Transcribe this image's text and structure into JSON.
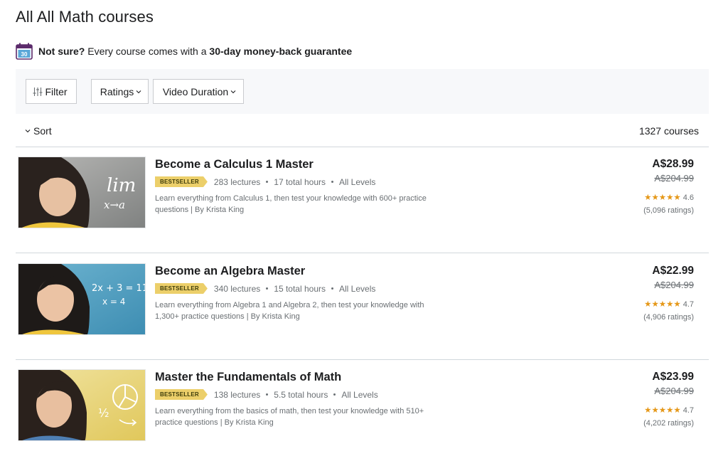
{
  "page": {
    "title": "All All Math courses"
  },
  "guarantee": {
    "lead": "Not sure?",
    "text": " Every course comes with a ",
    "highlight": "30-day money-back guarantee",
    "calendar_number": "30"
  },
  "filters": {
    "filter_label": "Filter",
    "ratings_label": "Ratings",
    "duration_label": "Video Duration"
  },
  "sort": {
    "label": "Sort",
    "count": "1327 courses"
  },
  "courses": [
    {
      "title": "Become a Calculus 1 Master",
      "badge": "BESTSELLER",
      "lectures": "283 lectures",
      "hours": "17 total hours",
      "level": "All Levels",
      "desc": "Learn everything from Calculus 1, then test your knowledge with 600+ practice questions | By Krista King",
      "price": "A$28.99",
      "original_price": "A$204.99",
      "rating": "4.6",
      "ratings_count": "(5,096 ratings)",
      "thumb_text_1": "lim",
      "thumb_text_2": "x→a"
    },
    {
      "title": "Become an Algebra Master",
      "badge": "BESTSELLER",
      "lectures": "340 lectures",
      "hours": "15 total hours",
      "level": "All Levels",
      "desc": "Learn everything from Algebra 1 and Algebra 2, then test your knowledge with 1,300+ practice questions | By Krista King",
      "price": "A$22.99",
      "original_price": "A$204.99",
      "rating": "4.7",
      "ratings_count": "(4,906 ratings)",
      "thumb_text_1": "2x + 3 = 11",
      "thumb_text_2": "x = 4"
    },
    {
      "title": "Master the Fundamentals of Math",
      "badge": "BESTSELLER",
      "lectures": "138 lectures",
      "hours": "5.5 total hours",
      "level": "All Levels",
      "desc": "Learn everything from the basics of math, then test your knowledge with 510+ practice questions | By Krista King",
      "price": "A$23.99",
      "original_price": "A$204.99",
      "rating": "4.7",
      "ratings_count": "(4,202 ratings)",
      "thumb_text_1": "½"
    }
  ],
  "colors": {
    "star": "#e59819",
    "badge": "#eccf6a",
    "muted_text": "#6a6f73",
    "filter_bar_bg": "#f7f8fa"
  }
}
